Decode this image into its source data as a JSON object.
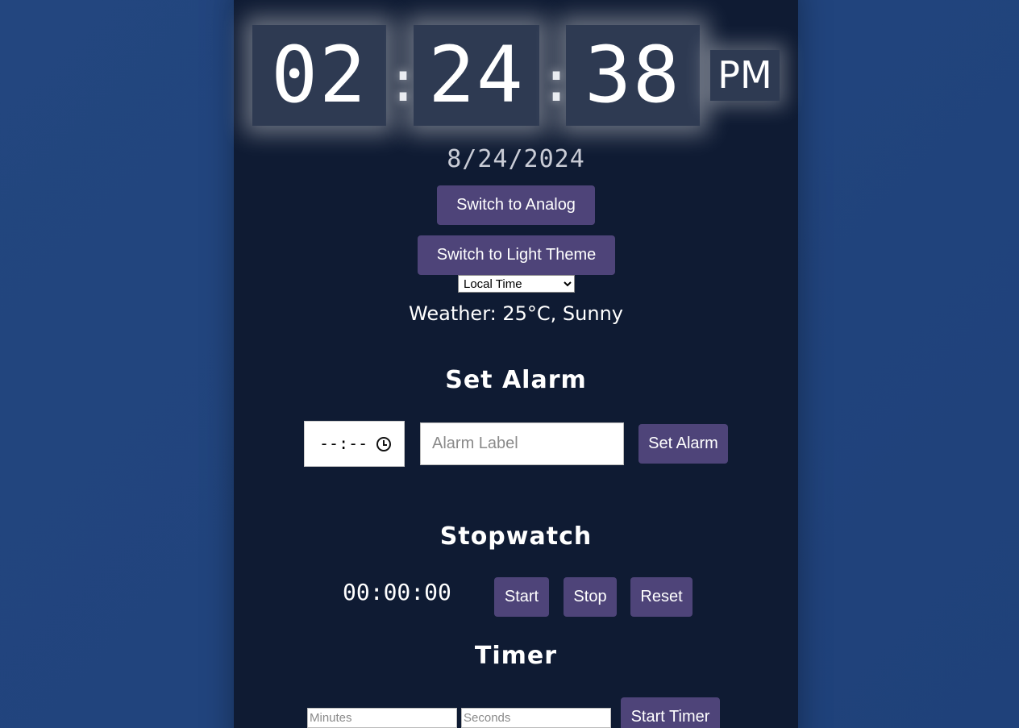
{
  "clock": {
    "hours": "02",
    "minutes": "24",
    "seconds": "38",
    "separator": ":",
    "ampm": "PM"
  },
  "date": "8/24/2024",
  "controls": {
    "switch_mode_label": "Switch to Analog",
    "switch_theme_label": "Switch to Light Theme",
    "timezone_selected": "Local Time"
  },
  "weather": "Weather: 25°C, Sunny",
  "alarm": {
    "title": "Set Alarm",
    "time_placeholder": "--:--",
    "label_placeholder": "Alarm Label",
    "button_label": "Set Alarm"
  },
  "stopwatch": {
    "title": "Stopwatch",
    "display": "00:00:00",
    "start_label": "Start",
    "stop_label": "Stop",
    "reset_label": "Reset"
  },
  "timer": {
    "title": "Timer",
    "minutes_placeholder": "Minutes",
    "seconds_placeholder": "Seconds",
    "button_label": "Start Timer"
  },
  "colors": {
    "background": "#22457e",
    "panel": "#0f1b33",
    "button": "#4e4479",
    "digit_box": "#2e3a52",
    "text": "#ffffff"
  },
  "icons": {
    "time_input": "clock-icon",
    "select": "chevron-down-icon"
  }
}
